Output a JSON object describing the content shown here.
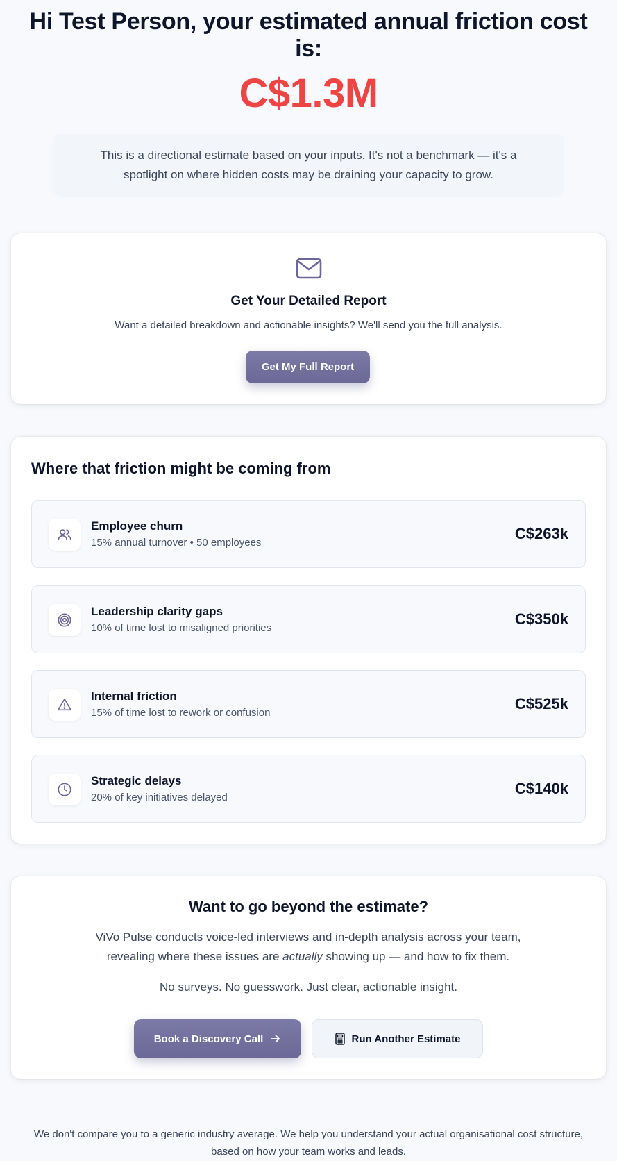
{
  "header": {
    "headline": "Hi Test Person, your estimated annual friction cost is:",
    "amount": "C$1.3M",
    "amount_color": "#ef4444",
    "disclaimer": "This is a directional estimate based on your inputs. It's not a benchmark — it's a spotlight on where hidden costs may be draining your capacity to grow."
  },
  "report": {
    "icon": "mail-icon",
    "title": "Get Your Detailed Report",
    "subtitle": "Want a detailed breakdown and actionable insights? We'll send you the full analysis.",
    "button_label": "Get My Full Report"
  },
  "friction": {
    "title": "Where that friction might be coming from",
    "items": [
      {
        "icon": "users-icon",
        "name": "Employee churn",
        "detail": "15% annual turnover • 50 employees",
        "value": "C$263k"
      },
      {
        "icon": "target-icon",
        "name": "Leadership clarity gaps",
        "detail": "10% of time lost to misaligned priorities",
        "value": "C$350k"
      },
      {
        "icon": "warning-icon",
        "name": "Internal friction",
        "detail": "15% of time lost to rework or confusion",
        "value": "C$525k"
      },
      {
        "icon": "clock-icon",
        "name": "Strategic delays",
        "detail": "20% of key initiatives delayed",
        "value": "C$140k"
      }
    ]
  },
  "cta": {
    "title": "Want to go beyond the estimate?",
    "body_before": "ViVo Pulse conducts voice-led interviews and in-depth analysis across your team, revealing where these issues are ",
    "body_emphasis": "actually",
    "body_after": " showing up — and how to fix them.",
    "tagline": "No surveys. No guesswork. Just clear, actionable insight.",
    "primary_button": "Book a Discovery Call",
    "secondary_button": "Run Another Estimate"
  },
  "footer": {
    "note": "We don't compare you to a generic industry average. We help you understand your actual organisational cost structure, based on how your team works and leads."
  },
  "colors": {
    "accent": "#6b6897",
    "icon": "#6b6897",
    "background": "#f7f9fc"
  }
}
